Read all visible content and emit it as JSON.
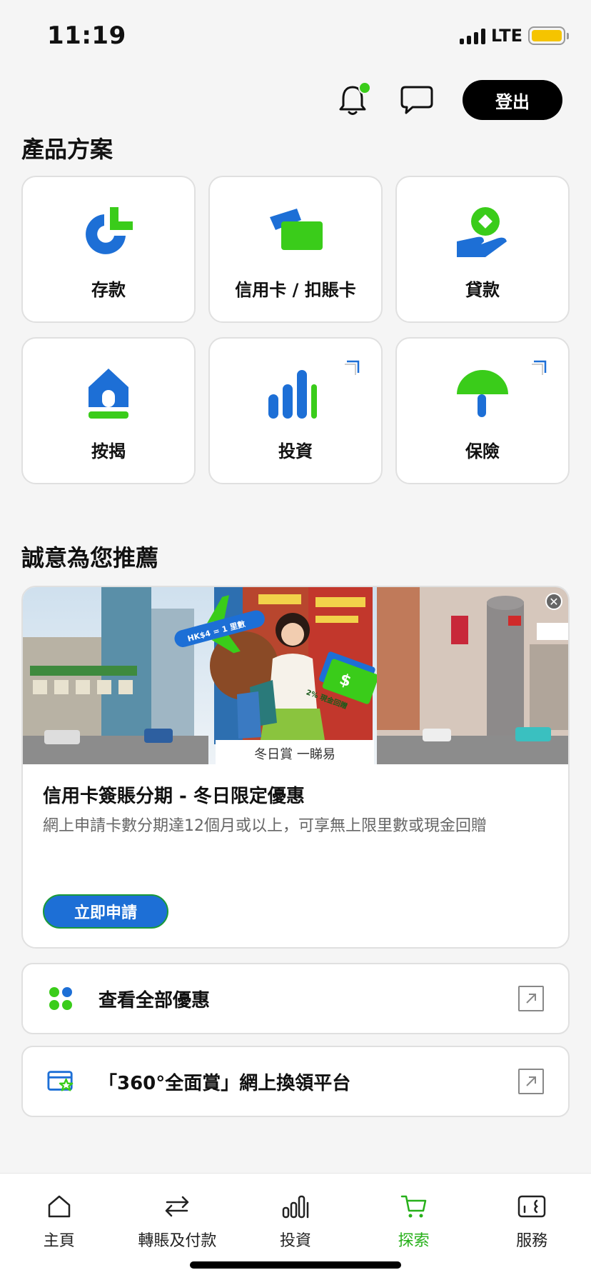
{
  "status_bar": {
    "time": "11:19",
    "network": "LTE"
  },
  "header": {
    "logout_label": "登出"
  },
  "products": {
    "title": "產品方案",
    "items": [
      {
        "label": "存款",
        "icon": "deposit-icon"
      },
      {
        "label": "信用卡 / 扣賬卡",
        "icon": "card-icon"
      },
      {
        "label": "貸款",
        "icon": "loan-icon"
      },
      {
        "label": "按揭",
        "icon": "mortgage-icon"
      },
      {
        "label": "投資",
        "icon": "investment-icon"
      },
      {
        "label": "保險",
        "icon": "insurance-icon"
      }
    ]
  },
  "recommend": {
    "title": "誠意為您推薦",
    "promo": {
      "banner_text_1": "HK$4 = 1 里數",
      "banner_text_2": "2% 現金回贈",
      "banner_caption": "冬日賞 一睇易",
      "title": "信用卡簽賬分期 - 冬日限定優惠",
      "description": "網上申請卡數分期達12個月或以上，可享無上限里數或現金回贈",
      "apply_label": "立即申請"
    }
  },
  "links": [
    {
      "label": "查看全部優惠"
    },
    {
      "label": "「360°全面賞」網上換領平台"
    }
  ],
  "tab_bar": {
    "items": [
      {
        "label": "主頁"
      },
      {
        "label": "轉賬及付款"
      },
      {
        "label": "投資"
      },
      {
        "label": "探索"
      },
      {
        "label": "服務"
      }
    ],
    "active_index": 3
  },
  "colors": {
    "accent_blue": "#1d6fd6",
    "accent_green": "#3acc1a",
    "active_tab": "#27b01a"
  }
}
